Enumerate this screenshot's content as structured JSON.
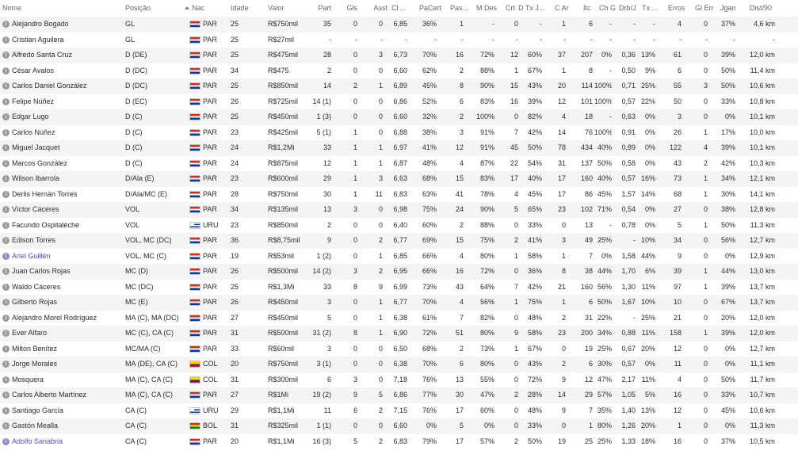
{
  "header": {
    "nome": "Nome",
    "posicao": "Posição",
    "nac": "Nac",
    "idade": "Idade",
    "valor": "Valor",
    "part": "Part",
    "gls": "Gls",
    "asst": "Asst",
    "cl": "Cl ...",
    "pacert": "PaCert",
    "pas": "Pas...",
    "mdes": "M Des",
    "crt": "Crt",
    "dtxj": "D Tx J...",
    "car": "C Ar",
    "itc": "Itc",
    "chg": "Ch G",
    "drbj": "Drb/J",
    "tx": "Tx ...",
    "erros": "Erros",
    "glerr": "Gl Err",
    "jgan": "Jgan",
    "dist": "Dist/90"
  },
  "sort_icon": "sort-asc-icon",
  "players": [
    {
      "name": "Alejandro Bogado",
      "pos": "GL",
      "nat": "PAR",
      "age": "25",
      "value": "R$750mil",
      "apps": "35",
      "gls": "0",
      "ast": "0",
      "cl": "6,85",
      "pacert": "36%",
      "pas": "1",
      "mdes": "-",
      "crt": "0",
      "dtx": "-",
      "car": "1",
      "itc": "6",
      "chg": "-",
      "drb": "-",
      "tx": "-",
      "err": "4",
      "glerr": "0",
      "jgan": "37%",
      "dist": "4,6 km",
      "link": false
    },
    {
      "name": "Cristian Aguilera",
      "pos": "GL",
      "nat": "PAR",
      "age": "25",
      "value": "R$27mil",
      "apps": "-",
      "gls": "-",
      "ast": "-",
      "cl": "-",
      "pacert": "-",
      "pas": "-",
      "mdes": "-",
      "crt": "-",
      "dtx": "-",
      "car": "-",
      "itc": "-",
      "chg": "-",
      "drb": "-",
      "tx": "-",
      "err": "-",
      "glerr": "-",
      "jgan": "-",
      "dist": "-",
      "link": false
    },
    {
      "name": "Alfredo Santa Cruz",
      "pos": "D (DE)",
      "nat": "PAR",
      "age": "25",
      "value": "R$475mil",
      "apps": "28",
      "gls": "0",
      "ast": "3",
      "cl": "6,73",
      "pacert": "70%",
      "pas": "16",
      "mdes": "72%",
      "crt": "12",
      "dtx": "60%",
      "car": "37",
      "itc": "207",
      "chg": "0%",
      "drb": "0,36",
      "tx": "13%",
      "err": "61",
      "glerr": "0",
      "jgan": "39%",
      "dist": "12,0 km",
      "link": false
    },
    {
      "name": "César Avalos",
      "pos": "D (DC)",
      "nat": "PAR",
      "age": "34",
      "value": "R$475",
      "apps": "2",
      "gls": "0",
      "ast": "0",
      "cl": "6,60",
      "pacert": "62%",
      "pas": "2",
      "mdes": "88%",
      "crt": "1",
      "dtx": "67%",
      "car": "1",
      "itc": "8",
      "chg": "-",
      "drb": "0,50",
      "tx": "9%",
      "err": "6",
      "glerr": "0",
      "jgan": "50%",
      "dist": "11,4 km",
      "link": false
    },
    {
      "name": "Carlos Daniel González",
      "pos": "D (DC)",
      "nat": "PAR",
      "age": "25",
      "value": "R$850mil",
      "apps": "14",
      "gls": "2",
      "ast": "1",
      "cl": "6,89",
      "pacert": "45%",
      "pas": "8",
      "mdes": "90%",
      "crt": "15",
      "dtx": "43%",
      "car": "20",
      "itc": "114",
      "chg": "100%",
      "drb": "0,71",
      "tx": "25%",
      "err": "55",
      "glerr": "3",
      "jgan": "50%",
      "dist": "10,6 km",
      "link": false
    },
    {
      "name": "Felipe Núñez",
      "pos": "D (EC)",
      "nat": "PAR",
      "age": "26",
      "value": "R$725mil",
      "apps": "14 (1)",
      "gls": "0",
      "ast": "0",
      "cl": "6,86",
      "pacert": "52%",
      "pas": "6",
      "mdes": "83%",
      "crt": "16",
      "dtx": "39%",
      "car": "12",
      "itc": "101",
      "chg": "100%",
      "drb": "0,57",
      "tx": "22%",
      "err": "50",
      "glerr": "0",
      "jgan": "33%",
      "dist": "10,8 km",
      "link": false
    },
    {
      "name": "Edgar Lugo",
      "pos": "D (C)",
      "nat": "PAR",
      "age": "25",
      "value": "R$450mil",
      "apps": "1 (3)",
      "gls": "0",
      "ast": "0",
      "cl": "6,60",
      "pacert": "32%",
      "pas": "2",
      "mdes": "100%",
      "crt": "0",
      "dtx": "82%",
      "car": "4",
      "itc": "18",
      "chg": "-",
      "drb": "0,63",
      "tx": "0%",
      "err": "3",
      "glerr": "0",
      "jgan": "0%",
      "dist": "10,1 km",
      "link": false
    },
    {
      "name": "Carlos Núñez",
      "pos": "D (C)",
      "nat": "PAR",
      "age": "23",
      "value": "R$425mil",
      "apps": "5 (1)",
      "gls": "1",
      "ast": "0",
      "cl": "6,88",
      "pacert": "38%",
      "pas": "3",
      "mdes": "91%",
      "crt": "7",
      "dtx": "42%",
      "car": "14",
      "itc": "76",
      "chg": "100%",
      "drb": "0,91",
      "tx": "0%",
      "err": "26",
      "glerr": "1",
      "jgan": "17%",
      "dist": "10,0 km",
      "link": false
    },
    {
      "name": "Miguel Jacquet",
      "pos": "D (C)",
      "nat": "PAR",
      "age": "24",
      "value": "R$1,2Mi",
      "apps": "33",
      "gls": "1",
      "ast": "1",
      "cl": "6,97",
      "pacert": "41%",
      "pas": "12",
      "mdes": "91%",
      "crt": "45",
      "dtx": "50%",
      "car": "78",
      "itc": "434",
      "chg": "40%",
      "drb": "0,89",
      "tx": "0%",
      "err": "122",
      "glerr": "4",
      "jgan": "39%",
      "dist": "10,1 km",
      "link": false
    },
    {
      "name": "Marcos González",
      "pos": "D (C)",
      "nat": "PAR",
      "age": "24",
      "value": "R$875mil",
      "apps": "12",
      "gls": "1",
      "ast": "1",
      "cl": "6,87",
      "pacert": "48%",
      "pas": "4",
      "mdes": "87%",
      "crt": "22",
      "dtx": "54%",
      "car": "31",
      "itc": "137",
      "chg": "50%",
      "drb": "0,58",
      "tx": "0%",
      "err": "43",
      "glerr": "2",
      "jgan": "42%",
      "dist": "10,3 km",
      "link": false
    },
    {
      "name": "Wilson Ibarrola",
      "pos": "D/Ala (E)",
      "nat": "PAR",
      "age": "23",
      "value": "R$600mil",
      "apps": "29",
      "gls": "1",
      "ast": "3",
      "cl": "6,63",
      "pacert": "68%",
      "pas": "15",
      "mdes": "83%",
      "crt": "17",
      "dtx": "40%",
      "car": "17",
      "itc": "160",
      "chg": "40%",
      "drb": "0,57",
      "tx": "16%",
      "err": "73",
      "glerr": "1",
      "jgan": "34%",
      "dist": "12,1 km",
      "link": false
    },
    {
      "name": "Derlis Hernán Torres",
      "pos": "D/Ala/MC (E)",
      "nat": "PAR",
      "age": "28",
      "value": "R$750mil",
      "apps": "30",
      "gls": "1",
      "ast": "11",
      "cl": "6,83",
      "pacert": "63%",
      "pas": "41",
      "mdes": "78%",
      "crt": "4",
      "dtx": "45%",
      "car": "17",
      "itc": "86",
      "chg": "45%",
      "drb": "1,57",
      "tx": "14%",
      "err": "68",
      "glerr": "1",
      "jgan": "30%",
      "dist": "14,1 km",
      "link": false
    },
    {
      "name": "Víctor Cáceres",
      "pos": "VOL",
      "nat": "PAR",
      "age": "34",
      "value": "R$135mil",
      "apps": "13",
      "gls": "3",
      "ast": "0",
      "cl": "6,98",
      "pacert": "75%",
      "pas": "24",
      "mdes": "90%",
      "crt": "5",
      "dtx": "65%",
      "car": "23",
      "itc": "102",
      "chg": "71%",
      "drb": "0,54",
      "tx": "0%",
      "err": "27",
      "glerr": "0",
      "jgan": "38%",
      "dist": "12,8 km",
      "link": false
    },
    {
      "name": "Facundo Ospitaleche",
      "pos": "VOL",
      "nat": "URU",
      "age": "23",
      "value": "R$850mil",
      "apps": "2",
      "gls": "0",
      "ast": "0",
      "cl": "6,40",
      "pacert": "60%",
      "pas": "2",
      "mdes": "88%",
      "crt": "0",
      "dtx": "33%",
      "car": "0",
      "itc": "13",
      "chg": "-",
      "drb": "0,78",
      "tx": "0%",
      "err": "5",
      "glerr": "1",
      "jgan": "50%",
      "dist": "11,3 km",
      "link": false
    },
    {
      "name": "Edison Torres",
      "pos": "VOL, MC (DC)",
      "nat": "PAR",
      "age": "36",
      "value": "R$8,75mil",
      "apps": "9",
      "gls": "0",
      "ast": "2",
      "cl": "6,77",
      "pacert": "69%",
      "pas": "15",
      "mdes": "75%",
      "crt": "2",
      "dtx": "41%",
      "car": "3",
      "itc": "49",
      "chg": "25%",
      "drb": "-",
      "tx": "10%",
      "err": "34",
      "glerr": "0",
      "jgan": "56%",
      "dist": "12,7 km",
      "link": false
    },
    {
      "name": "Ariel Guillén",
      "pos": "VOL, MC (C)",
      "nat": "PAR",
      "age": "19",
      "value": "R$53mil",
      "apps": "1 (2)",
      "gls": "0",
      "ast": "1",
      "cl": "6,85",
      "pacert": "66%",
      "pas": "4",
      "mdes": "80%",
      "crt": "1",
      "dtx": "58%",
      "car": "1",
      "itc": "7",
      "chg": "0%",
      "drb": "1,58",
      "tx": "44%",
      "err": "9",
      "glerr": "0",
      "jgan": "0%",
      "dist": "12,9 km",
      "link": true
    },
    {
      "name": "Juan Carlos Rojas",
      "pos": "MC (D)",
      "nat": "PAR",
      "age": "26",
      "value": "R$500mil",
      "apps": "14 (2)",
      "gls": "3",
      "ast": "2",
      "cl": "6,95",
      "pacert": "66%",
      "pas": "16",
      "mdes": "72%",
      "crt": "0",
      "dtx": "36%",
      "car": "8",
      "itc": "38",
      "chg": "44%",
      "drb": "1,70",
      "tx": "6%",
      "err": "39",
      "glerr": "1",
      "jgan": "44%",
      "dist": "13,0 km",
      "link": false
    },
    {
      "name": "Waldo Cáceres",
      "pos": "MC (DC)",
      "nat": "PAR",
      "age": "25",
      "value": "R$1,3Mi",
      "apps": "33",
      "gls": "8",
      "ast": "9",
      "cl": "6,99",
      "pacert": "73%",
      "pas": "43",
      "mdes": "64%",
      "crt": "7",
      "dtx": "42%",
      "car": "21",
      "itc": "160",
      "chg": "56%",
      "drb": "1,30",
      "tx": "11%",
      "err": "97",
      "glerr": "1",
      "jgan": "39%",
      "dist": "13,7 km",
      "link": false
    },
    {
      "name": "Gilberto Rojas",
      "pos": "MC (E)",
      "nat": "PAR",
      "age": "26",
      "value": "R$450mil",
      "apps": "3",
      "gls": "0",
      "ast": "1",
      "cl": "6,77",
      "pacert": "70%",
      "pas": "4",
      "mdes": "56%",
      "crt": "1",
      "dtx": "75%",
      "car": "1",
      "itc": "6",
      "chg": "50%",
      "drb": "1,67",
      "tx": "10%",
      "err": "10",
      "glerr": "0",
      "jgan": "67%",
      "dist": "13,7 km",
      "link": false
    },
    {
      "name": "Alejandro Morel Rodríguez",
      "pos": "MA (C), MA (DC)",
      "nat": "PAR",
      "age": "27",
      "value": "R$450mil",
      "apps": "5",
      "gls": "0",
      "ast": "1",
      "cl": "6,38",
      "pacert": "61%",
      "pas": "7",
      "mdes": "82%",
      "crt": "0",
      "dtx": "48%",
      "car": "2",
      "itc": "31",
      "chg": "22%",
      "drb": "-",
      "tx": "25%",
      "err": "21",
      "glerr": "0",
      "jgan": "20%",
      "dist": "12,0 km",
      "link": false
    },
    {
      "name": "Ever Alfaro",
      "pos": "MC (C), CA (C)",
      "nat": "PAR",
      "age": "31",
      "value": "R$500mil",
      "apps": "31 (2)",
      "gls": "8",
      "ast": "1",
      "cl": "6,90",
      "pacert": "72%",
      "pas": "51",
      "mdes": "80%",
      "crt": "9",
      "dtx": "58%",
      "car": "23",
      "itc": "200",
      "chg": "34%",
      "drb": "0,88",
      "tx": "11%",
      "err": "158",
      "glerr": "1",
      "jgan": "39%",
      "dist": "12,0 km",
      "link": false
    },
    {
      "name": "Milton Benítez",
      "pos": "MC/MA (C)",
      "nat": "PAR",
      "age": "33",
      "value": "R$60mil",
      "apps": "3",
      "gls": "0",
      "ast": "0",
      "cl": "6,50",
      "pacert": "68%",
      "pas": "2",
      "mdes": "73%",
      "crt": "1",
      "dtx": "67%",
      "car": "0",
      "itc": "19",
      "chg": "25%",
      "drb": "0,67",
      "tx": "20%",
      "err": "12",
      "glerr": "0",
      "jgan": "0%",
      "dist": "12,7 km",
      "link": false
    },
    {
      "name": "Jorge Morales",
      "pos": "MA (DE), CA (C)",
      "nat": "COL",
      "age": "20",
      "value": "R$750mil",
      "apps": "3 (1)",
      "gls": "0",
      "ast": "0",
      "cl": "6,38",
      "pacert": "70%",
      "pas": "6",
      "mdes": "80%",
      "crt": "0",
      "dtx": "43%",
      "car": "2",
      "itc": "6",
      "chg": "30%",
      "drb": "0,57",
      "tx": "0%",
      "err": "11",
      "glerr": "0",
      "jgan": "0%",
      "dist": "11,1 km",
      "link": false
    },
    {
      "name": "Mosquera",
      "pos": "MA (C), CA (C)",
      "nat": "COL",
      "age": "31",
      "value": "R$300mil",
      "apps": "6",
      "gls": "3",
      "ast": "0",
      "cl": "7,18",
      "pacert": "76%",
      "pas": "13",
      "mdes": "55%",
      "crt": "0",
      "dtx": "72%",
      "car": "9",
      "itc": "12",
      "chg": "47%",
      "drb": "2,17",
      "tx": "11%",
      "err": "4",
      "glerr": "0",
      "jgan": "50%",
      "dist": "11,7 km",
      "link": false
    },
    {
      "name": "Carlos Alberto Martínez",
      "pos": "MA (C), CA (C)",
      "nat": "PAR",
      "age": "27",
      "value": "R$1Mi",
      "apps": "19 (2)",
      "gls": "9",
      "ast": "5",
      "cl": "6,86",
      "pacert": "77%",
      "pas": "30",
      "mdes": "47%",
      "crt": "2",
      "dtx": "28%",
      "car": "14",
      "itc": "29",
      "chg": "57%",
      "drb": "1,05",
      "tx": "5%",
      "err": "16",
      "glerr": "0",
      "jgan": "33%",
      "dist": "10,7 km",
      "link": false
    },
    {
      "name": "Santiago García",
      "pos": "CA (C)",
      "nat": "URU",
      "age": "29",
      "value": "R$1,1Mi",
      "apps": "11",
      "gls": "6",
      "ast": "2",
      "cl": "7,15",
      "pacert": "76%",
      "pas": "17",
      "mdes": "60%",
      "crt": "0",
      "dtx": "48%",
      "car": "9",
      "itc": "7",
      "chg": "35%",
      "drb": "1,40",
      "tx": "13%",
      "err": "12",
      "glerr": "0",
      "jgan": "45%",
      "dist": "10,6 km",
      "link": false
    },
    {
      "name": "Gastón Mealla",
      "pos": "CA (C)",
      "nat": "BOL",
      "age": "31",
      "value": "R$325mil",
      "apps": "1 (1)",
      "gls": "0",
      "ast": "0",
      "cl": "6,60",
      "pacert": "0%",
      "pas": "5",
      "mdes": "0%",
      "crt": "0",
      "dtx": "33%",
      "car": "0",
      "itc": "1",
      "chg": "80%",
      "drb": "1,26",
      "tx": "20%",
      "err": "1",
      "glerr": "0",
      "jgan": "0%",
      "dist": "11,3 km",
      "link": false
    },
    {
      "name": "Adolfo Sanabria",
      "pos": "CA (C)",
      "nat": "PAR",
      "age": "20",
      "value": "R$1,1Mi",
      "apps": "16 (3)",
      "gls": "5",
      "ast": "2",
      "cl": "6,83",
      "pacert": "79%",
      "pas": "17",
      "mdes": "57%",
      "crt": "2",
      "dtx": "50%",
      "car": "19",
      "itc": "25",
      "chg": "25%",
      "drb": "1,33",
      "tx": "18%",
      "err": "16",
      "glerr": "0",
      "jgan": "37%",
      "dist": "10,5 km",
      "link": true
    }
  ]
}
